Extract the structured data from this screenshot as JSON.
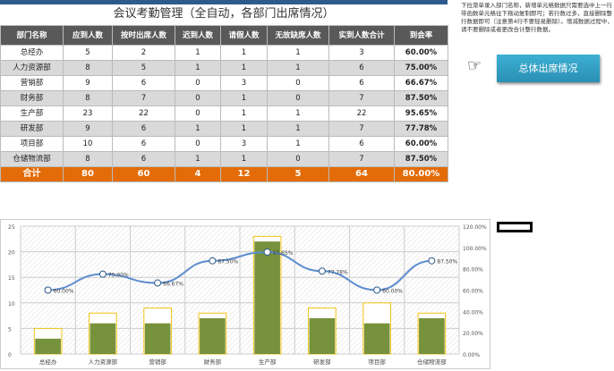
{
  "title": "会议考勤管理（全自动，各部门出席情况）",
  "table": {
    "headers": [
      "部门名称",
      "应到人数",
      "按时出席人数",
      "迟到人数",
      "请假人数",
      "无故缺席人数",
      "实到人数合计",
      "到会率"
    ],
    "rows": [
      [
        "总经办",
        "5",
        "2",
        "1",
        "1",
        "1",
        "3",
        "60.00%"
      ],
      [
        "人力资源部",
        "8",
        "5",
        "1",
        "1",
        "1",
        "6",
        "75.00%"
      ],
      [
        "营销部",
        "9",
        "6",
        "0",
        "3",
        "0",
        "6",
        "66.67%"
      ],
      [
        "财务部",
        "8",
        "7",
        "0",
        "1",
        "0",
        "7",
        "87.50%"
      ],
      [
        "生产部",
        "23",
        "22",
        "0",
        "1",
        "1",
        "22",
        "95.65%"
      ],
      [
        "研发部",
        "9",
        "6",
        "1",
        "1",
        "1",
        "7",
        "77.78%"
      ],
      [
        "项目部",
        "10",
        "6",
        "0",
        "3",
        "1",
        "6",
        "60.00%"
      ],
      [
        "仓储物流部",
        "8",
        "6",
        "1",
        "1",
        "0",
        "7",
        "87.50%"
      ]
    ],
    "total": [
      "合计",
      "80",
      "60",
      "4",
      "12",
      "5",
      "64",
      "80.00%"
    ]
  },
  "notice": "下拉菜单录入部门名称，新增单元格数据只需要选中上一行带函数单元格往下拖动复制即可；若行数过多，直接删除整行数据即可（注意第4行不要轻易删除）。增减数据过程中，请不要删除或者更改合计整行数据。",
  "button_label": "总体出席情况",
  "colors": {
    "header": "#595959",
    "total": "#e36c09",
    "bar": "#76923c",
    "bar_outline": "#f2c314",
    "line": "#5b8ccf"
  },
  "chart_data": {
    "type": "bar",
    "categories": [
      "总经办",
      "人力资源部",
      "营销部",
      "财务部",
      "生产部",
      "研发部",
      "项目部",
      "仓储物流部"
    ],
    "series": [
      {
        "name": "应到人数",
        "type": "bar",
        "values": [
          5,
          8,
          9,
          8,
          23,
          9,
          10,
          8
        ]
      },
      {
        "name": "实到人数合计",
        "type": "bar",
        "values": [
          3,
          6,
          6,
          7,
          22,
          7,
          6,
          7
        ]
      },
      {
        "name": "到会率",
        "type": "line",
        "axis": "right",
        "values": [
          60,
          75,
          66.67,
          87.5,
          95.65,
          77.78,
          60,
          87.5
        ],
        "labels": [
          "60.00%",
          "75.00%",
          "66.67%",
          "87.50%",
          "95.65%",
          "77.78%",
          "60.00%",
          "87.50%"
        ]
      }
    ],
    "ylim": [
      0,
      25
    ],
    "yticks": [
      "0",
      "5",
      "10",
      "15",
      "20",
      "25"
    ],
    "y2lim": [
      0,
      120
    ],
    "y2ticks": [
      "0.00%",
      "20.00%",
      "40.00%",
      "60.00%",
      "80.00%",
      "100.00%",
      "120.00%"
    ]
  }
}
